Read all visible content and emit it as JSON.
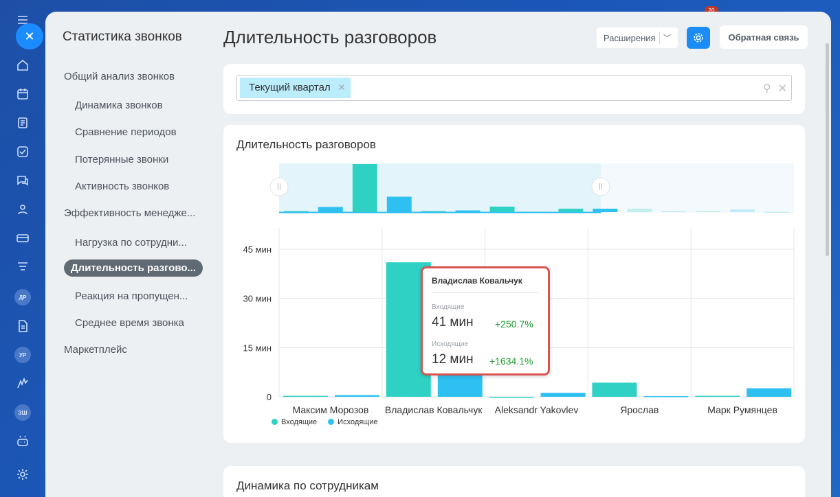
{
  "rail": {
    "close_label": "✕",
    "icons": [
      "menu-icon",
      "home-icon",
      "calendar-icon",
      "document-icon",
      "tasks-icon",
      "chat-icon",
      "users-icon",
      "card-icon",
      "filter-icon",
      "avatar-dr",
      "file-icon",
      "avatar-ur",
      "logo-icon",
      "avatar-zsh",
      "robot-icon",
      "settings-icon"
    ],
    "avatars": {
      "dr": "ДР",
      "ur": "УР",
      "zsh": "ЗШ"
    },
    "badge": "20"
  },
  "sidebar": {
    "title": "Статистика звонков",
    "items": [
      {
        "label": "Общий анализ звонков",
        "level": 0,
        "active": false
      },
      {
        "label": "Динамика звонков",
        "level": 1,
        "active": false
      },
      {
        "label": "Сравнение периодов",
        "level": 1,
        "active": false
      },
      {
        "label": "Потерянные звонки",
        "level": 1,
        "active": false
      },
      {
        "label": "Активность звонков",
        "level": 1,
        "active": false
      },
      {
        "label": "Эффективность менедже...",
        "level": 0,
        "active": false
      },
      {
        "label": "Нагрузка по сотрудни...",
        "level": 1,
        "active": false
      },
      {
        "label": "Длительность разгово...",
        "level": 1,
        "active": true
      },
      {
        "label": "Реакция на пропущен...",
        "level": 1,
        "active": false
      },
      {
        "label": "Среднее время звонка",
        "level": 1,
        "active": false
      },
      {
        "label": "Маркетплейс",
        "level": 0,
        "active": false
      }
    ]
  },
  "header": {
    "title": "Длительность разговоров",
    "extensions_label": "Расширения",
    "feedback_label": "Обратная связь"
  },
  "filter": {
    "chip_label": "Текущий квартал"
  },
  "chart_panel": {
    "title": "Длительность разговоров"
  },
  "chart_data": {
    "type": "bar",
    "categories": [
      "Максим Морозов",
      "Владислав Ковальчук",
      "Aleksandr Yakovlev",
      "Ярослав",
      "Марк Румянцев"
    ],
    "series": [
      {
        "name": "Входящие",
        "color": "#2fd1c4",
        "values": [
          0.3,
          41,
          0,
          4.3,
          0.3
        ]
      },
      {
        "name": "Исходящие",
        "color": "#2fc0f2",
        "values": [
          0.5,
          12,
          1.2,
          0.2,
          2.6
        ]
      }
    ],
    "ylim": [
      0,
      45
    ],
    "yticks": [
      0,
      15,
      30,
      45
    ],
    "ytick_labels": [
      "0",
      "15 мин",
      "30 мин",
      "45 мин"
    ],
    "grid": true,
    "legend": "bottom-left",
    "overview_values": [
      0.3,
      1.5,
      14,
      4.5,
      0.3,
      0.5,
      1.6,
      0.1,
      1,
      1,
      1,
      0.3,
      0.3,
      0.8,
      0.1
    ]
  },
  "tooltip": {
    "name": "Владислав Ковальчук",
    "incoming_label": "Входящие",
    "incoming_value": "41 мин",
    "incoming_delta": "+250.7%",
    "outgoing_label": "Исходящие",
    "outgoing_value": "12 мин",
    "outgoing_delta": "+1634.1%"
  },
  "second_panel": {
    "title": "Динамика по сотрудникам"
  }
}
